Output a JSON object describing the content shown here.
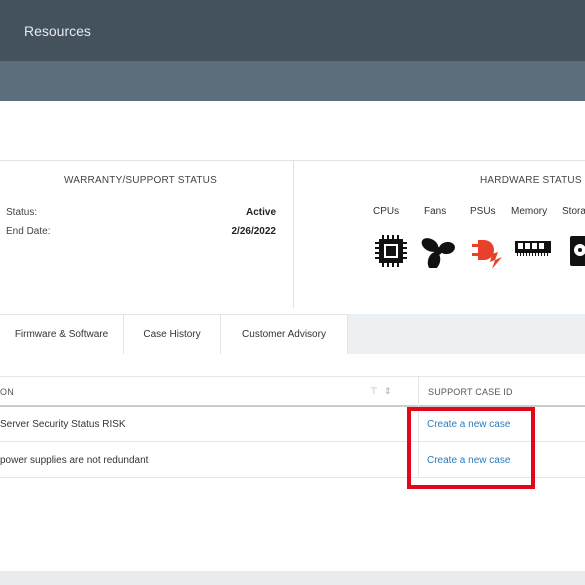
{
  "header": {
    "title": "Resources"
  },
  "warranty": {
    "heading": "WARRANTY/SUPPORT STATUS",
    "status_label": "Status:",
    "status_value": "Active",
    "end_date_label": "End Date:",
    "end_date_value": "2/26/2022"
  },
  "hardware": {
    "heading": "HARDWARE STATUS",
    "items": [
      "CPUs",
      "Fans",
      "PSUs",
      "Memory",
      "Stora"
    ],
    "icons": [
      "cpu-icon",
      "fan-icon",
      "power-plug-warning-icon",
      "memory-icon",
      "storage-icon"
    ],
    "status_colors": {
      "ok": "#111111",
      "warning": "#e8402a"
    }
  },
  "tabs": [
    "Firmware & Software",
    "Case History",
    "Customer Advisory"
  ],
  "table": {
    "columns": [
      "ON",
      "SUPPORT CASE ID"
    ],
    "rows": [
      {
        "description": "Server Security Status RISK",
        "case": "Create a new case"
      },
      {
        "description": "power supplies are not redundant",
        "case": "Create a new case"
      }
    ]
  },
  "colors": {
    "header": "#44525e",
    "subheader": "#5c6d7b",
    "link": "#2b7bbd",
    "highlight": "#e3061a"
  }
}
